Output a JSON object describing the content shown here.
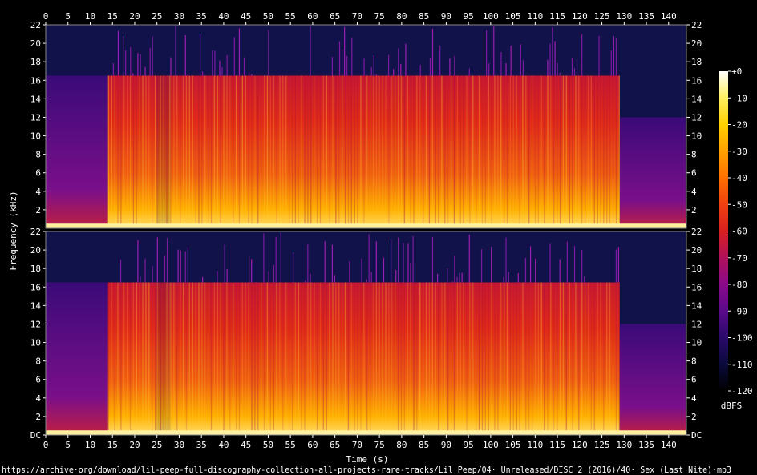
{
  "chart_data": {
    "type": "heatmap",
    "title": "",
    "xlabel": "Time (s)",
    "ylabel": "Frequency (kHz)",
    "xlim": [
      0,
      144
    ],
    "x_ticks": [
      0,
      5,
      10,
      15,
      20,
      25,
      30,
      35,
      40,
      45,
      50,
      55,
      60,
      65,
      70,
      75,
      80,
      85,
      90,
      95,
      100,
      105,
      110,
      115,
      120,
      125,
      130,
      135,
      140
    ],
    "ylim_khz": [
      0,
      22
    ],
    "channels": [
      {
        "y_tick_labels": [
          "22",
          "20",
          "18",
          "16",
          "14",
          "12",
          "10",
          "8",
          "6",
          "4",
          "2"
        ],
        "y_tick_values": [
          22,
          20,
          18,
          16,
          14,
          12,
          10,
          8,
          6,
          4,
          2
        ]
      },
      {
        "y_tick_labels": [
          "22",
          "20",
          "18",
          "16",
          "14",
          "12",
          "10",
          "8",
          "6",
          "4",
          "2",
          "DC"
        ],
        "y_tick_values": [
          22,
          20,
          18,
          16,
          14,
          12,
          10,
          8,
          6,
          4,
          2,
          0
        ]
      }
    ],
    "colorbar": {
      "label": "dBFS",
      "tick_labels": [
        "+0",
        "-10",
        "-20",
        "-30",
        "-40",
        "-50",
        "-60",
        "-70",
        "-80",
        "-90",
        "-100",
        "-110",
        "-120"
      ],
      "range_db": [
        -120,
        0
      ],
      "colors": [
        "#000000",
        "#0a0a3c",
        "#2a0a6a",
        "#5a0a8a",
        "#8a0a8a",
        "#b0105a",
        "#d82020",
        "#f04010",
        "#ff7000",
        "#ffa000",
        "#ffd000",
        "#fff060",
        "#ffffff"
      ]
    },
    "segments": [
      {
        "t_start": 0,
        "t_end": 14,
        "cutoff_khz": 16.5,
        "level": "low"
      },
      {
        "t_start": 14,
        "t_end": 25,
        "cutoff_khz": 16.5,
        "level": "high"
      },
      {
        "t_start": 25,
        "t_end": 28,
        "cutoff_khz": 16.5,
        "level": "mid"
      },
      {
        "t_start": 28,
        "t_end": 129,
        "cutoff_khz": 16.5,
        "level": "high"
      },
      {
        "t_start": 129,
        "t_end": 144,
        "cutoff_khz": 12,
        "level": "low"
      }
    ]
  },
  "footer": {
    "source": "https://archive·org/download/lil-peep-full-discography-collection-all-projects-rare-tracks/Lil Peep/04· Unreleased/DISC 2 (2016)/40· Sex (Last Nite)·mp3"
  }
}
